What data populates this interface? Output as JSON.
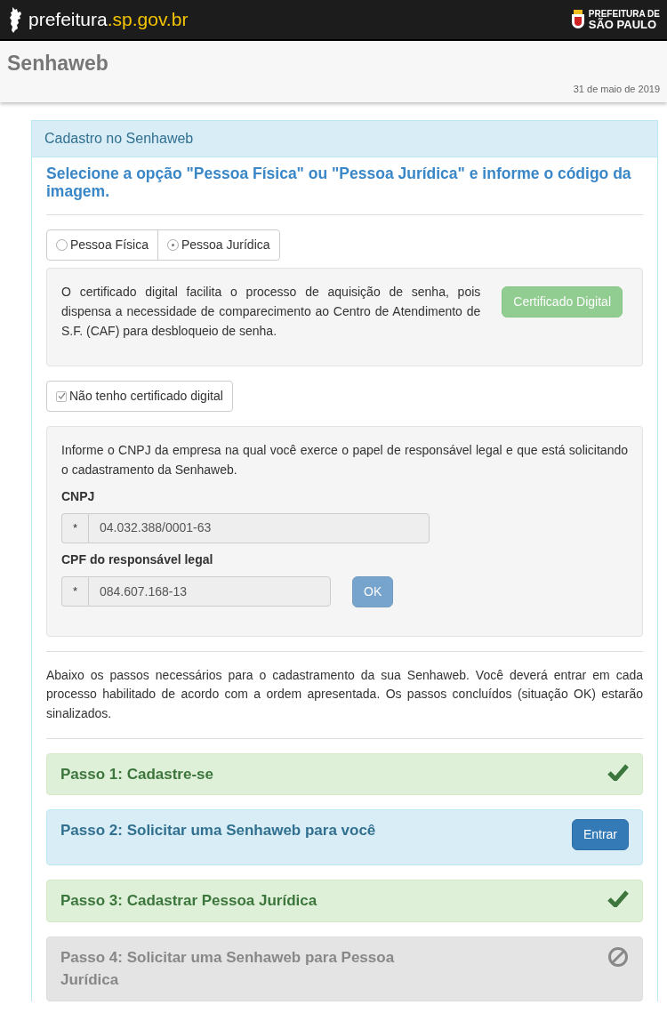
{
  "topbar": {
    "site_name": "prefeitura",
    "site_domain": ".sp.gov.br",
    "brand_line_1": "PREFEITURA DE",
    "brand_line_2": "SÃO PAULO"
  },
  "page": {
    "title": "Senhaweb",
    "date": "31 de maio de 2019"
  },
  "panel": {
    "heading": "Cadastro no Senhaweb",
    "instruction": "Selecione a opção \"Pessoa Física\" ou \"Pessoa Jurídica\" e informe o código da imagem.",
    "person_types": [
      {
        "label": "Pessoa Física",
        "selected": false
      },
      {
        "label": "Pessoa Jurídica",
        "selected": true
      }
    ],
    "certificate_info": {
      "text": "O certificado digital facilita o processo de aquisição de senha, pois dispensa a necessidade de comparecimento ao Centro de Atendimento de S.F. (CAF) para desbloqueio de senha.",
      "button": {
        "label": "Certificado Digital",
        "disabled": true
      }
    },
    "no_certificate": {
      "label": "Não tenho certificado digital",
      "checked": true
    },
    "company_form": {
      "intro": "Informe o CNPJ da empresa na qual você exerce o papel de responsável legal e que está solicitando o cadastramento da Senhaweb.",
      "fields": [
        {
          "label": "CNPJ",
          "addon": "*",
          "value": "04.032.388/0001-63",
          "disabled": true
        },
        {
          "label": "CPF do responsável legal",
          "addon": "*",
          "value": "084.607.168-13",
          "disabled": true
        }
      ],
      "ok_button": {
        "label": "OK",
        "disabled": true
      }
    },
    "steps_intro": "Abaixo os passos necessários para o cadastramento da sua Senhaweb. Você deverá entrar em cada processo habilitado de acordo com a ordem apresentada. Os passos concluídos (situação OK) estarão sinalizados.",
    "steps": [
      {
        "title": "**Passo 1:** Cadastre-se",
        "kind": "done"
      },
      {
        "title": "**Passo 2:** Solicitar uma Senhaweb para você",
        "kind": "active",
        "button": "Entrar"
      },
      {
        "title": "**Passo 3:** Cadastrar Pessoa Jurídica",
        "kind": "done"
      },
      {
        "title": "**Passo 4:** Solicitar uma Senhaweb para Pessoa Jurídica",
        "kind": "blocked"
      }
    ]
  }
}
